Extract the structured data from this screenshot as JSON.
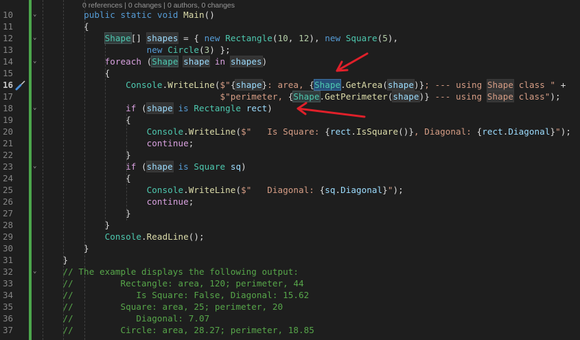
{
  "codelens": "0 references | 0 changes | 0 authors, 0 changes",
  "current_line": 16,
  "colors": {
    "accent_change_bar": "#4ca64c",
    "arrow": "#e0202a",
    "background": "#1e1e1e"
  },
  "fold_lines": [
    10,
    12,
    14,
    18,
    23,
    32
  ],
  "lines": [
    {
      "n": 10,
      "t": [
        [
          "        ",
          ""
        ],
        [
          "public",
          "kw"
        ],
        [
          " ",
          ""
        ],
        [
          "static",
          "kw"
        ],
        [
          " ",
          ""
        ],
        [
          "void",
          "kw"
        ],
        [
          " ",
          ""
        ],
        [
          "Main",
          "me"
        ],
        [
          "()",
          "pl"
        ]
      ]
    },
    {
      "n": 11,
      "t": [
        [
          "        {",
          "pl"
        ]
      ]
    },
    {
      "n": 12,
      "t": [
        [
          "            ",
          ""
        ],
        [
          "Shape",
          "ty",
          "hlt"
        ],
        [
          "[] ",
          "pl"
        ],
        [
          "shapes",
          "va",
          "hl"
        ],
        [
          " = { ",
          "pl"
        ],
        [
          "new",
          "kw"
        ],
        [
          " ",
          ""
        ],
        [
          "Rectangle",
          "ty"
        ],
        [
          "(",
          "pl"
        ],
        [
          "10",
          "nu"
        ],
        [
          ", ",
          "pl"
        ],
        [
          "12",
          "nu"
        ],
        [
          "), ",
          "pl"
        ],
        [
          "new",
          "kw"
        ],
        [
          " ",
          ""
        ],
        [
          "Square",
          "ty"
        ],
        [
          "(",
          "pl"
        ],
        [
          "5",
          "nu"
        ],
        [
          "),",
          "pl"
        ]
      ]
    },
    {
      "n": 13,
      "t": [
        [
          "                    ",
          ""
        ],
        [
          "new",
          "kw"
        ],
        [
          " ",
          ""
        ],
        [
          "Circle",
          "ty"
        ],
        [
          "(",
          "pl"
        ],
        [
          "3",
          "nu"
        ],
        [
          ") };",
          "pl"
        ]
      ]
    },
    {
      "n": 14,
      "t": [
        [
          "            ",
          ""
        ],
        [
          "foreach",
          "ctl"
        ],
        [
          " (",
          "pl"
        ],
        [
          "Shape",
          "ty",
          "hlt"
        ],
        [
          " ",
          ""
        ],
        [
          "shape",
          "va",
          "hl"
        ],
        [
          " ",
          ""
        ],
        [
          "in",
          "ctl"
        ],
        [
          " ",
          ""
        ],
        [
          "shapes",
          "va",
          "hl"
        ],
        [
          ")",
          "pl"
        ]
      ]
    },
    {
      "n": 15,
      "t": [
        [
          "            {",
          "pl"
        ]
      ]
    },
    {
      "n": 16,
      "t": [
        [
          "                ",
          ""
        ],
        [
          "Console",
          "ty"
        ],
        [
          ".",
          "pl"
        ],
        [
          "WriteLine",
          "me"
        ],
        [
          "(",
          "pl"
        ],
        [
          "$\"",
          "st"
        ],
        [
          "{",
          "pl"
        ],
        [
          "shape",
          "va",
          "hl"
        ],
        [
          "}",
          "pl"
        ],
        [
          ": area, ",
          "st"
        ],
        [
          "{",
          "pl"
        ],
        [
          "Shape",
          "ty",
          "sel"
        ],
        [
          ".",
          "pl"
        ],
        [
          "GetArea",
          "me"
        ],
        [
          "(",
          "pl"
        ],
        [
          "shape",
          "va",
          "hl"
        ],
        [
          ")}",
          "pl"
        ],
        [
          "; --- using ",
          "st"
        ],
        [
          "Shape",
          "st",
          "hl"
        ],
        [
          " class \"",
          "st"
        ],
        [
          " +",
          "pl"
        ]
      ]
    },
    {
      "n": 17,
      "t": [
        [
          "                                  ",
          ""
        ],
        [
          "$\"perimeter, ",
          "st"
        ],
        [
          "{",
          "pl"
        ],
        [
          "Shape",
          "ty",
          "hlt"
        ],
        [
          ".",
          "pl"
        ],
        [
          "GetPerimeter",
          "me"
        ],
        [
          "(",
          "pl"
        ],
        [
          "shape",
          "va",
          "hl"
        ],
        [
          ")}",
          "pl"
        ],
        [
          " --- using ",
          "st"
        ],
        [
          "Shape",
          "st",
          "hl"
        ],
        [
          " class\"",
          "st"
        ],
        [
          ");",
          "pl"
        ]
      ]
    },
    {
      "n": 18,
      "t": [
        [
          "                ",
          ""
        ],
        [
          "if",
          "ctl"
        ],
        [
          " (",
          "pl"
        ],
        [
          "shape",
          "va",
          "hl"
        ],
        [
          " ",
          ""
        ],
        [
          "is",
          "kw"
        ],
        [
          " ",
          ""
        ],
        [
          "Rectangle",
          "ty"
        ],
        [
          " ",
          ""
        ],
        [
          "rect",
          "va"
        ],
        [
          ")",
          "pl"
        ]
      ]
    },
    {
      "n": 19,
      "t": [
        [
          "                {",
          "pl"
        ]
      ]
    },
    {
      "n": 20,
      "t": [
        [
          "                    ",
          ""
        ],
        [
          "Console",
          "ty"
        ],
        [
          ".",
          "pl"
        ],
        [
          "WriteLine",
          "me"
        ],
        [
          "(",
          "pl"
        ],
        [
          "$\"   Is Square: ",
          "st"
        ],
        [
          "{",
          "pl"
        ],
        [
          "rect",
          "va"
        ],
        [
          ".",
          "pl"
        ],
        [
          "IsSquare",
          "me"
        ],
        [
          "()}",
          "pl"
        ],
        [
          ", Diagonal: ",
          "st"
        ],
        [
          "{",
          "pl"
        ],
        [
          "rect",
          "va"
        ],
        [
          ".",
          "pl"
        ],
        [
          "Diagonal",
          "va"
        ],
        [
          "}",
          "pl"
        ],
        [
          "\"",
          "st"
        ],
        [
          ");",
          "pl"
        ]
      ]
    },
    {
      "n": 21,
      "t": [
        [
          "                    ",
          ""
        ],
        [
          "continue",
          "ctl"
        ],
        [
          ";",
          "pl"
        ]
      ]
    },
    {
      "n": 22,
      "t": [
        [
          "                }",
          "pl"
        ]
      ]
    },
    {
      "n": 23,
      "t": [
        [
          "                ",
          ""
        ],
        [
          "if",
          "ctl"
        ],
        [
          " (",
          "pl"
        ],
        [
          "shape",
          "va",
          "hl"
        ],
        [
          " ",
          ""
        ],
        [
          "is",
          "kw"
        ],
        [
          " ",
          ""
        ],
        [
          "Square",
          "ty"
        ],
        [
          " ",
          ""
        ],
        [
          "sq",
          "va"
        ],
        [
          ")",
          "pl"
        ]
      ]
    },
    {
      "n": 24,
      "t": [
        [
          "                {",
          "pl"
        ]
      ]
    },
    {
      "n": 25,
      "t": [
        [
          "                    ",
          ""
        ],
        [
          "Console",
          "ty"
        ],
        [
          ".",
          "pl"
        ],
        [
          "WriteLine",
          "me"
        ],
        [
          "(",
          "pl"
        ],
        [
          "$\"   Diagonal: ",
          "st"
        ],
        [
          "{",
          "pl"
        ],
        [
          "sq",
          "va"
        ],
        [
          ".",
          "pl"
        ],
        [
          "Diagonal",
          "va"
        ],
        [
          "}",
          "pl"
        ],
        [
          "\"",
          "st"
        ],
        [
          ");",
          "pl"
        ]
      ]
    },
    {
      "n": 26,
      "t": [
        [
          "                    ",
          ""
        ],
        [
          "continue",
          "ctl"
        ],
        [
          ";",
          "pl"
        ]
      ]
    },
    {
      "n": 27,
      "t": [
        [
          "                }",
          "pl"
        ]
      ]
    },
    {
      "n": 28,
      "t": [
        [
          "            }",
          "pl"
        ]
      ]
    },
    {
      "n": 29,
      "t": [
        [
          "            ",
          ""
        ],
        [
          "Console",
          "ty"
        ],
        [
          ".",
          "pl"
        ],
        [
          "ReadLine",
          "me"
        ],
        [
          "();",
          "pl"
        ]
      ]
    },
    {
      "n": 30,
      "t": [
        [
          "        }",
          "pl"
        ]
      ]
    },
    {
      "n": 31,
      "t": [
        [
          "    }",
          "pl"
        ]
      ]
    },
    {
      "n": 32,
      "t": [
        [
          "    ",
          ""
        ],
        [
          "// The example displays the following output:",
          "cm"
        ]
      ]
    },
    {
      "n": 33,
      "t": [
        [
          "    ",
          ""
        ],
        [
          "//         Rectangle: area, 120; perimeter, 44",
          "cm"
        ]
      ]
    },
    {
      "n": 34,
      "t": [
        [
          "    ",
          ""
        ],
        [
          "//            Is Square: False, Diagonal: 15.62",
          "cm"
        ]
      ]
    },
    {
      "n": 35,
      "t": [
        [
          "    ",
          ""
        ],
        [
          "//         Square: area, 25; perimeter, 20",
          "cm"
        ]
      ]
    },
    {
      "n": 36,
      "t": [
        [
          "    ",
          ""
        ],
        [
          "//            Diagonal: 7.07",
          "cm"
        ]
      ]
    },
    {
      "n": 37,
      "t": [
        [
          "    ",
          ""
        ],
        [
          "//         Circle: area, 28.27; perimeter, 18.85",
          "cm"
        ]
      ]
    }
  ]
}
